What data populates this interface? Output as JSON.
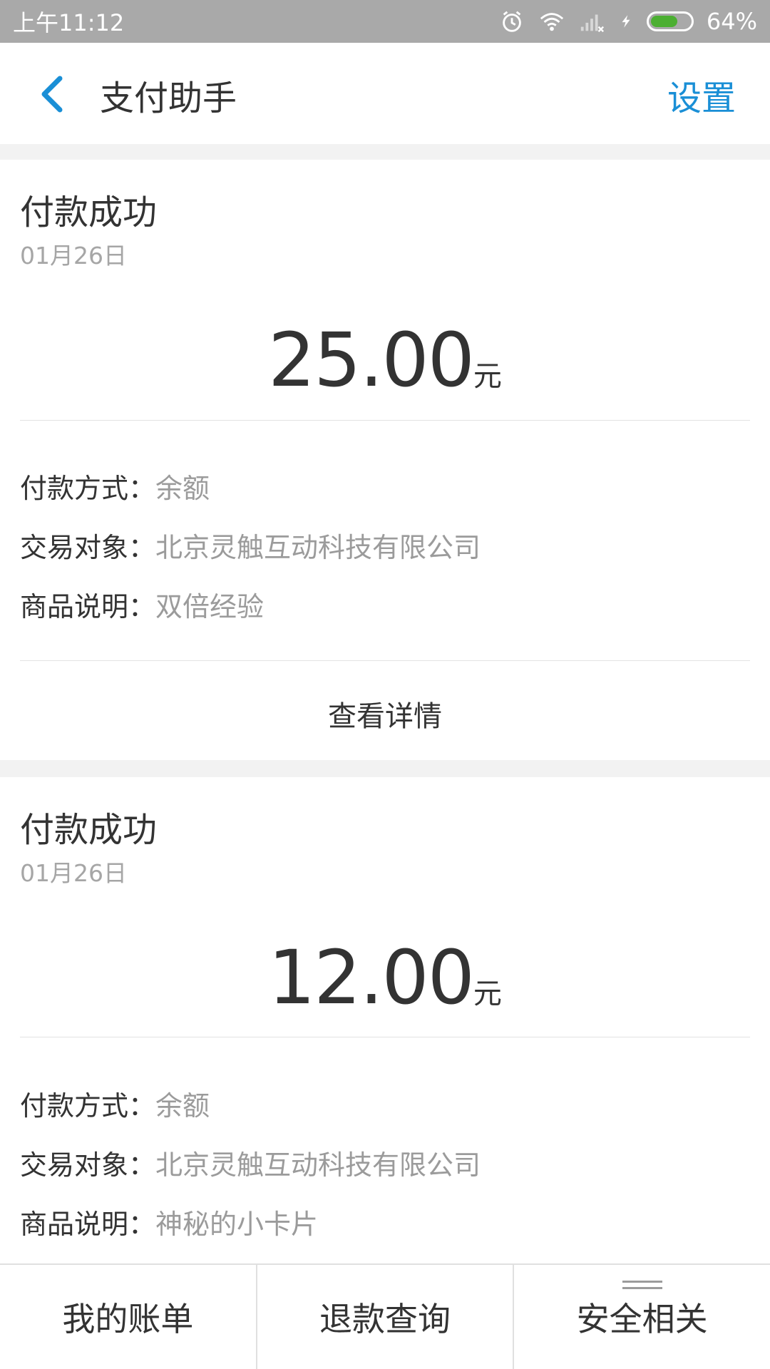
{
  "status_bar": {
    "time": "上午11:12",
    "battery": "64%",
    "battery_level": 0.64,
    "icons": [
      "alarm-icon",
      "wifi-icon",
      "signal-icon",
      "charging-icon",
      "battery-icon"
    ]
  },
  "nav": {
    "back_icon": "chevron-left-icon",
    "title": "支付助手",
    "settings": "设置",
    "accent_color": "#1a8fd6"
  },
  "cards": [
    {
      "status": "付款成功",
      "date": "01月26日",
      "amount": "25.00",
      "unit": "元",
      "rows": [
        {
          "label": "付款方式：",
          "value": "余额"
        },
        {
          "label": "交易对象：",
          "value": "北京灵触互动科技有限公司"
        },
        {
          "label": "商品说明：",
          "value": "双倍经验"
        }
      ],
      "details": "查看详情"
    },
    {
      "status": "付款成功",
      "date": "01月26日",
      "amount": "12.00",
      "unit": "元",
      "rows": [
        {
          "label": "付款方式：",
          "value": "余额"
        },
        {
          "label": "交易对象：",
          "value": "北京灵触互动科技有限公司"
        },
        {
          "label": "商品说明：",
          "value": "神秘的小卡片"
        }
      ]
    }
  ],
  "tabbar": {
    "tabs": [
      "我的账单",
      "退款查询",
      "安全相关"
    ],
    "menu_icon": "menu-icon"
  }
}
